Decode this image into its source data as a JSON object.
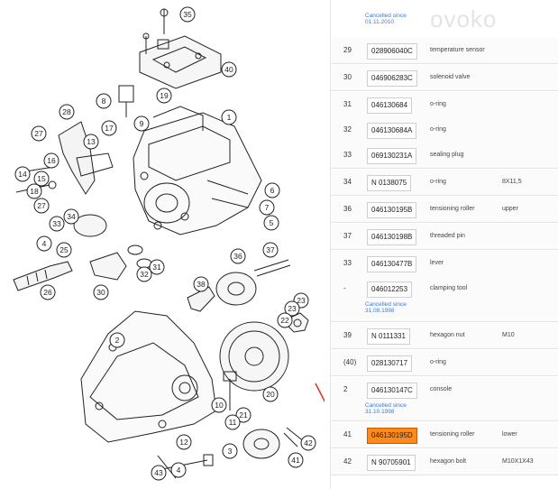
{
  "watermark": "ovoko",
  "top_cancel": [
    "Cancelled since",
    "01.11.2010"
  ],
  "rows": [
    {
      "pos": "29",
      "part": "028906040C",
      "desc": "temperature sensor",
      "spec": ""
    },
    {
      "pos": "30",
      "part": "046906283C",
      "desc": "solenoid valve",
      "spec": ""
    },
    {
      "pos": "31",
      "part": "046130684",
      "desc": "o-ring",
      "spec": ""
    },
    {
      "pos": "32",
      "part": "046130684A",
      "desc": "o-ring",
      "spec": ""
    },
    {
      "pos": "33",
      "part": "069130231A",
      "desc": "sealing plug",
      "spec": ""
    },
    {
      "pos": "34",
      "part": "N 0138075",
      "desc": "o-ring",
      "spec": "8X11,5"
    },
    {
      "pos": "36",
      "part": "046130195B",
      "desc": "tensioning roller",
      "spec": "upper"
    },
    {
      "pos": "37",
      "part": "046130198B",
      "desc": "threaded pin",
      "spec": ""
    },
    {
      "pos": "33",
      "part": "046130477B",
      "desc": "lever",
      "spec": ""
    },
    {
      "pos": "-",
      "part": "046012253",
      "desc": "clamping tool",
      "spec": "",
      "cancel": [
        "Cancelled since",
        "31.08.1998"
      ]
    },
    {
      "pos": "39",
      "part": "N 0111331",
      "desc": "hexagon nut",
      "spec": "M10"
    },
    {
      "pos": "(40)",
      "part": "028130717",
      "desc": "o-ring",
      "spec": ""
    },
    {
      "pos": "2",
      "part": "046130147C",
      "desc": "console",
      "spec": "",
      "cancel": [
        "Cancelled since",
        "31.10.1998"
      ]
    },
    {
      "pos": "41",
      "part": "046130195D",
      "desc": "tensioning roller",
      "spec": "lower",
      "highlight": true
    },
    {
      "pos": "42",
      "part": "N 90705901",
      "desc": "hexagon bolt",
      "spec": "M10X1X43"
    }
  ],
  "callouts": [
    "35",
    "1",
    "40",
    "8",
    "19",
    "9",
    "28",
    "27",
    "16",
    "13",
    "17",
    "14",
    "15",
    "18",
    "6",
    "7",
    "5",
    "27",
    "34",
    "33",
    "25",
    "4",
    "23",
    "31",
    "32",
    "37",
    "26",
    "30",
    "36",
    "38",
    "23",
    "22",
    "2",
    "20",
    "21",
    "10",
    "11",
    "12",
    "3",
    "41",
    "42",
    "43",
    "4",
    "5"
  ]
}
